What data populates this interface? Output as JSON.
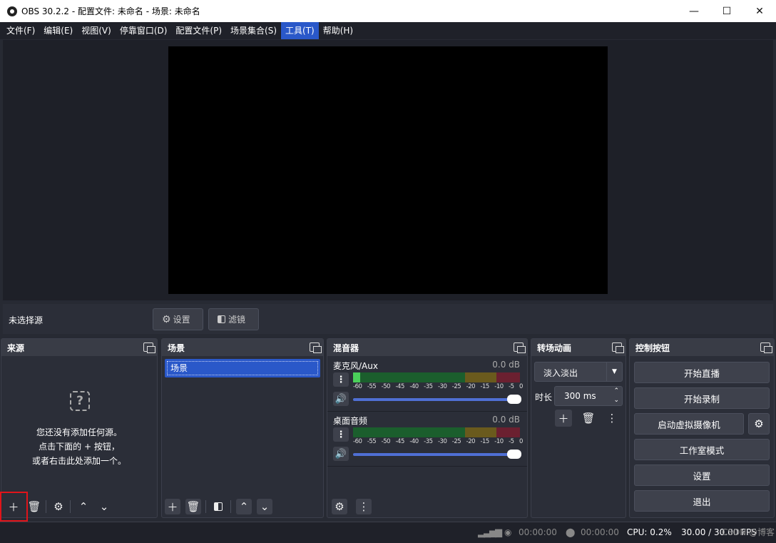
{
  "window": {
    "title": "OBS 30.2.2 - 配置文件: 未命名 - 场景: 未命名"
  },
  "menu": [
    "文件(F)",
    "编辑(E)",
    "视图(V)",
    "停靠窗口(D)",
    "配置文件(P)",
    "场景集合(S)",
    "工具(T)",
    "帮助(H)"
  ],
  "active_menu": "工具(T)",
  "context": {
    "no_source": "未选择源",
    "settings_btn": "设置",
    "filters_btn": "滤镜"
  },
  "sources": {
    "title": "来源",
    "empty_line1": "您还没有添加任何源。",
    "empty_line2": "点击下面的 + 按钮，",
    "empty_line3": "或者右击此处添加一个。"
  },
  "scenes": {
    "title": "场景",
    "items": [
      "场景"
    ]
  },
  "mixer": {
    "title": "混音器",
    "ticks": [
      "-60",
      "-55",
      "-50",
      "-45",
      "-40",
      "-35",
      "-30",
      "-25",
      "-20",
      "-15",
      "-10",
      "-5",
      "0"
    ],
    "channels": [
      {
        "name": "麦克风/Aux",
        "db": "0.0 dB",
        "volume_pct": 100
      },
      {
        "name": "桌面音频",
        "db": "0.0 dB",
        "volume_pct": 100
      }
    ]
  },
  "transitions": {
    "title": "转场动画",
    "selected": "淡入淡出",
    "duration_label": "时长",
    "duration_value": "300 ms"
  },
  "controls": {
    "title": "控制按钮",
    "buttons": [
      "开始直播",
      "开始录制",
      "启动虚拟摄像机",
      "工作室模式",
      "设置",
      "退出"
    ]
  },
  "status": {
    "rec_time1": "00:00:00",
    "rec_time2": "00:00:00",
    "cpu": "CPU: 0.2%",
    "fps": "30.00 / 30.00 FPS",
    "watermark": "CSDN @博客"
  },
  "colors": {
    "accent": "#2a58c9",
    "highlight_box": "#e0141a"
  }
}
